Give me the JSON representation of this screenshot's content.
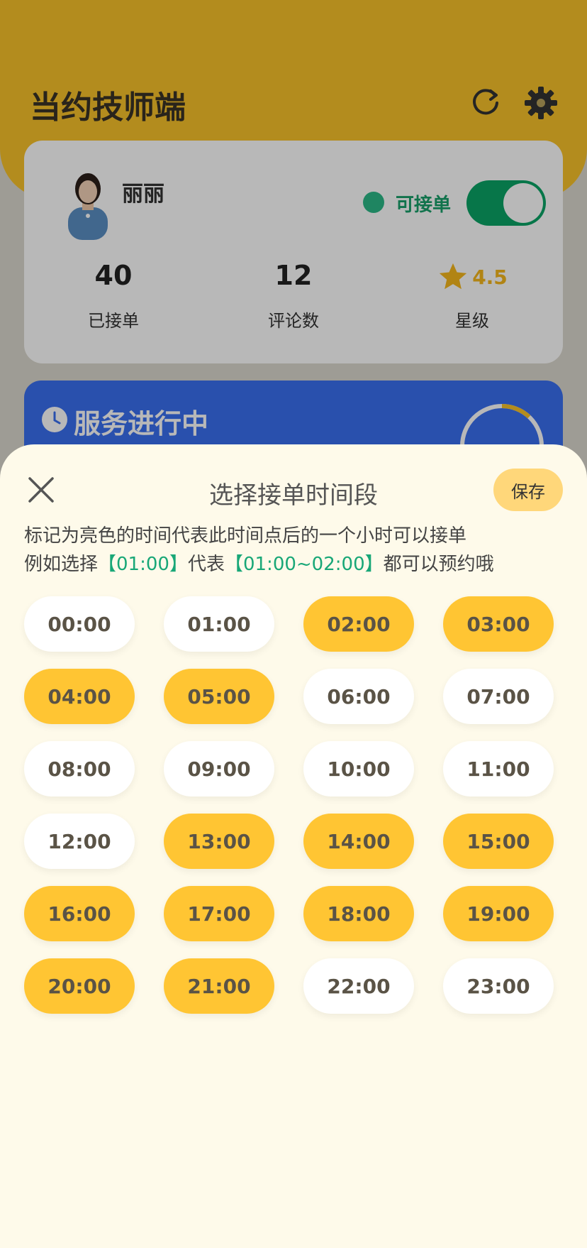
{
  "app": {
    "title": "当约技师端"
  },
  "header": {
    "refresh_icon": "refresh-icon",
    "settings_icon": "gear-icon"
  },
  "profile": {
    "name": "丽丽",
    "status_text": "可接单",
    "toggle_on": true,
    "stats": [
      {
        "value": "40",
        "label": "已接单"
      },
      {
        "value": "12",
        "label": "评论数"
      },
      {
        "value": "4.5",
        "label": "星级"
      }
    ]
  },
  "service": {
    "title": "服务进行中",
    "progress_fraction": 0.12
  },
  "colors": {
    "accent": "#FFC533",
    "brand_green": "#18a777",
    "service_blue": "#3a6ff0"
  },
  "sheet": {
    "title": "选择接单时间段",
    "save_label": "保存",
    "desc_line1": "标记为亮色的时间代表此时间点后的一个小时可以接单",
    "desc2_prefix": "例如选择",
    "desc2_ex1": "【01:00】",
    "desc2_mid": "代表",
    "desc2_ex2": "【01:00~02:00】",
    "desc2_suffix": "都可以预约哦",
    "slots": [
      {
        "label": "00:00",
        "on": false
      },
      {
        "label": "01:00",
        "on": false
      },
      {
        "label": "02:00",
        "on": true
      },
      {
        "label": "03:00",
        "on": true
      },
      {
        "label": "04:00",
        "on": true
      },
      {
        "label": "05:00",
        "on": true
      },
      {
        "label": "06:00",
        "on": false
      },
      {
        "label": "07:00",
        "on": false
      },
      {
        "label": "08:00",
        "on": false
      },
      {
        "label": "09:00",
        "on": false
      },
      {
        "label": "10:00",
        "on": false
      },
      {
        "label": "11:00",
        "on": false
      },
      {
        "label": "12:00",
        "on": false
      },
      {
        "label": "13:00",
        "on": true
      },
      {
        "label": "14:00",
        "on": true
      },
      {
        "label": "15:00",
        "on": true
      },
      {
        "label": "16:00",
        "on": true
      },
      {
        "label": "17:00",
        "on": true
      },
      {
        "label": "18:00",
        "on": true
      },
      {
        "label": "19:00",
        "on": true
      },
      {
        "label": "20:00",
        "on": true
      },
      {
        "label": "21:00",
        "on": true
      },
      {
        "label": "22:00",
        "on": false
      },
      {
        "label": "23:00",
        "on": false
      }
    ]
  }
}
